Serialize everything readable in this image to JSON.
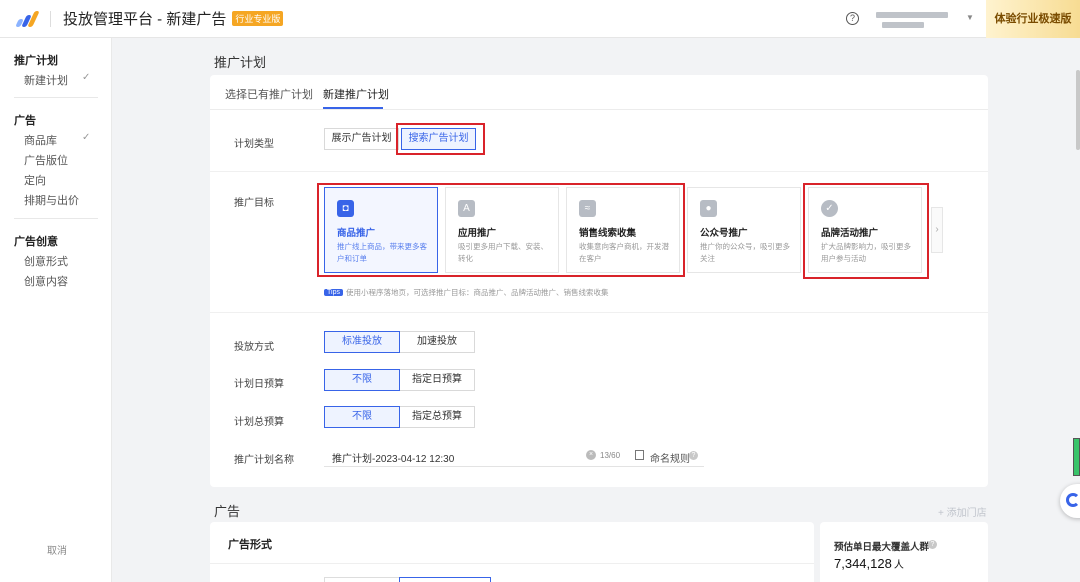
{
  "header": {
    "app_title": "投放管理平台 - 新建广告",
    "badge": "行业专业版",
    "help_icon": "?",
    "ribbon": "体验行业极速版"
  },
  "sidebar": {
    "section_plan": "推广计划",
    "item_new_plan": "新建计划",
    "section_ad": "广告",
    "items_ad": [
      "商品库",
      "广告版位",
      "定向",
      "排期与出价"
    ],
    "section_creative": "广告创意",
    "items_creative": [
      "创意形式",
      "创意内容"
    ],
    "check": "✓",
    "cancel": "取消"
  },
  "main": {
    "page_title": "推广计划",
    "tabs": [
      "选择已有推广计划",
      "新建推广计划"
    ],
    "plan_type": {
      "label": "计划类型",
      "options": [
        "展示广告计划",
        "搜索广告计划"
      ]
    },
    "goal": {
      "label": "推广目标",
      "cards": [
        {
          "icon": "bag-icon",
          "glyph": "◘",
          "title": "商品推广",
          "desc": "推广线上商品，带来更多客户和订单"
        },
        {
          "icon": "app-icon",
          "glyph": "A",
          "title": "应用推广",
          "desc": "吸引更多用户下载、安装、转化"
        },
        {
          "icon": "leads-icon",
          "glyph": "≈",
          "title": "销售线索收集",
          "desc": "收集意向客户商机，开发潜在客户"
        },
        {
          "icon": "account-icon",
          "glyph": "●",
          "title": "公众号推广",
          "desc": "推广你的公众号，吸引更多关注"
        },
        {
          "icon": "brand-icon",
          "glyph": "✓",
          "title": "品牌活动推广",
          "desc": "扩大品牌影响力，吸引更多用户参与活动"
        }
      ],
      "next_arrow": "›",
      "tips_badge": "Tips",
      "tips_text": "使用小程序落地页，可选择推广目标：商品推广、品牌活动推广、销售线索收集"
    },
    "delivery": {
      "label": "投放方式",
      "options": [
        "标准投放",
        "加速投放"
      ]
    },
    "daily_budget": {
      "label": "计划日预算",
      "options": [
        "不限",
        "指定日预算"
      ]
    },
    "total_budget": {
      "label": "计划总预算",
      "options": [
        "不限",
        "指定总预算"
      ]
    },
    "plan_name": {
      "label": "推广计划名称",
      "value": "推广计划-2023-04-12 12:30",
      "clear": "×",
      "counter": "13/60",
      "rule_link": "命名规则",
      "help": "?"
    }
  },
  "ad": {
    "section_title": "广告",
    "add_store": "+ 添加门店",
    "format_title": "广告形式",
    "estimate_title": "预估单日最大覆盖人群",
    "estimate_help": "?",
    "estimate_value": "7,344,128",
    "estimate_unit": "人"
  },
  "colors": {
    "accent": "#3864e8",
    "highlight_box": "#d9232a",
    "badge": "#f5a623"
  }
}
